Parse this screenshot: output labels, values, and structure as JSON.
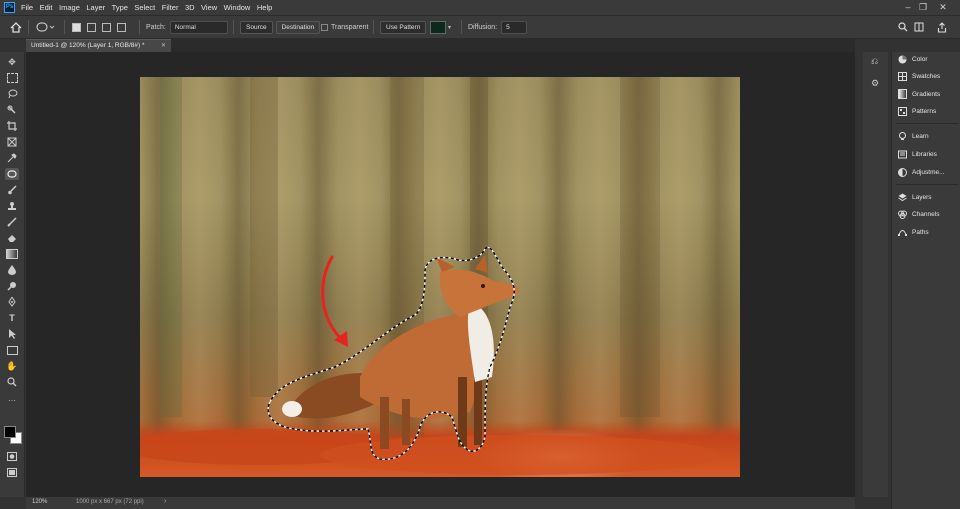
{
  "app": {
    "logo_text": "Ps"
  },
  "menu": [
    "File",
    "Edit",
    "Image",
    "Layer",
    "Type",
    "Select",
    "Filter",
    "3D",
    "View",
    "Window",
    "Help"
  ],
  "options": {
    "patch_label": "Patch:",
    "patch_value": "Normal",
    "source_label": "Source",
    "destination_label": "Destination",
    "transparent_label": "Transparent",
    "use_pattern_label": "Use Pattern",
    "diffusion_label": "Diffusion:",
    "diffusion_value": "5"
  },
  "document": {
    "tab_title": "Untitled-1 @ 120% (Layer 1, RGB/8#) *",
    "zoom": "120%",
    "dimensions": "1000 px x 667 px (72 ppi)"
  },
  "panels": {
    "group1": [
      "Color",
      "Swatches",
      "Gradients",
      "Patterns"
    ],
    "group2": [
      "Learn",
      "Libraries",
      "Adjustme..."
    ],
    "group3": [
      "Layers",
      "Channels",
      "Paths"
    ]
  },
  "colors": {
    "accent_arrow": "#e8231f",
    "foreground": "#000000",
    "background": "#ffffff"
  }
}
